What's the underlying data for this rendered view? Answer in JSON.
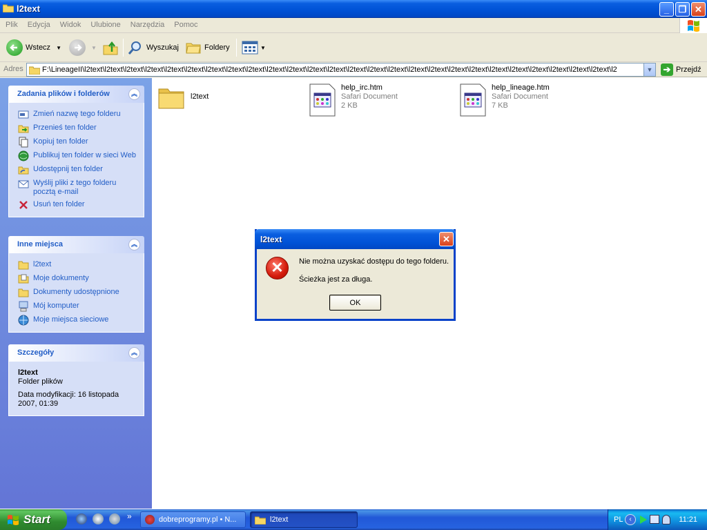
{
  "window": {
    "title": "l2text"
  },
  "menu": [
    "Plik",
    "Edycja",
    "Widok",
    "Ulubione",
    "Narzędzia",
    "Pomoc"
  ],
  "toolbar": {
    "back_label": "Wstecz",
    "search_label": "Wyszukaj",
    "folders_label": "Foldery"
  },
  "address": {
    "label": "Adres",
    "value": "F:\\LineageII\\l2text\\l2text\\l2text\\l2text\\l2text\\l2text\\l2text\\l2text\\l2text\\l2text\\l2text\\l2text\\l2text\\l2text\\l2text\\l2text\\l2text\\l2text\\l2text\\l2text\\l2text\\l2text\\l2text\\l2text\\l2text\\l2text\\l2",
    "go_label": "Przejdź"
  },
  "tasks_panel": {
    "title": "Zadania plików i folderów",
    "items": [
      "Zmień nazwę tego folderu",
      "Przenieś ten folder",
      "Kopiuj ten folder",
      "Publikuj ten folder w sieci Web",
      "Udostępnij ten folder",
      "Wyślij pliki z tego folderu pocztą e-mail",
      "Usuń ten folder"
    ]
  },
  "places_panel": {
    "title": "Inne miejsca",
    "items": [
      "l2text",
      "Moje dokumenty",
      "Dokumenty udostępnione",
      "Mój komputer",
      "Moje miejsca sieciowe"
    ]
  },
  "details_panel": {
    "title": "Szczegóły",
    "name": "l2text",
    "type": "Folder plików",
    "modified": "Data modyfikacji: 16 listopada 2007, 01:39"
  },
  "files": [
    {
      "name": "l2text",
      "type": "",
      "size": ""
    },
    {
      "name": "help_irc.htm",
      "type": "Safari Document",
      "size": "2 KB"
    },
    {
      "name": "help_lineage.htm",
      "type": "Safari Document",
      "size": "7 KB"
    }
  ],
  "dialog": {
    "title": "l2text",
    "message1": "Nie można uzyskać dostępu do tego folderu.",
    "message2": "Ścieżka jest za długa.",
    "ok_label": "OK"
  },
  "taskbar": {
    "start_label": "Start",
    "tasks": [
      "dobreprogramy.pl • N...",
      "l2text"
    ],
    "language": "PL",
    "clock": "11:21",
    "overflow": "»"
  }
}
